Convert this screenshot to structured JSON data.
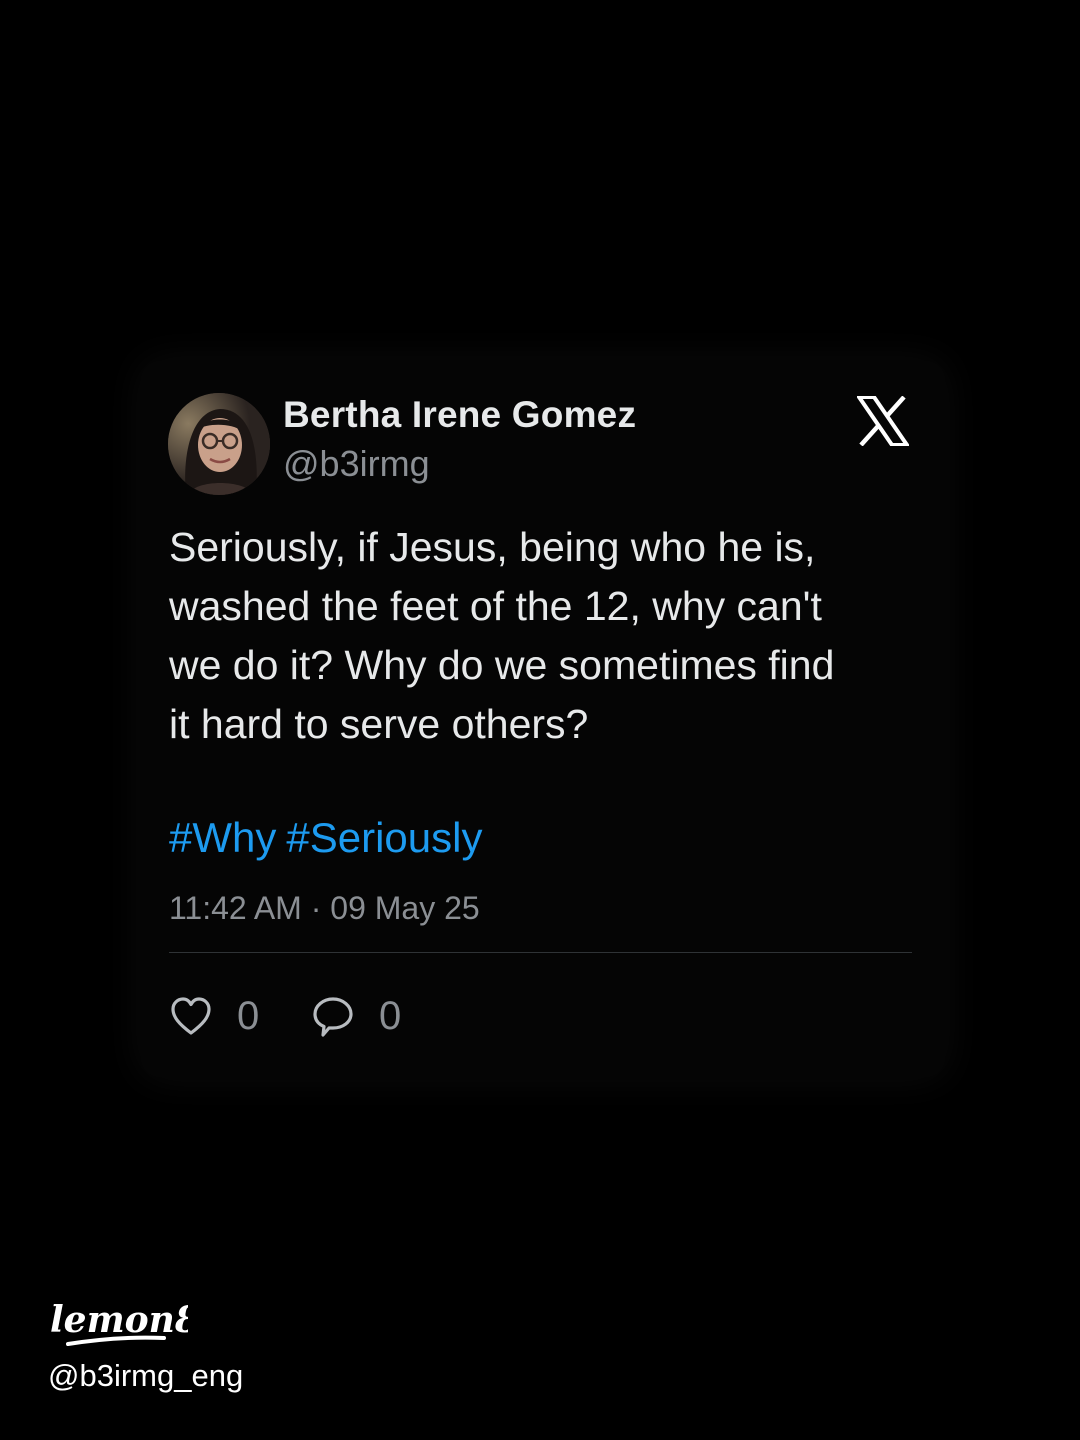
{
  "tweet": {
    "author": {
      "display_name": "Bertha Irene Gomez",
      "handle": "@b3irmg"
    },
    "text_lines": [
      "Seriously, if Jesus, being who he is,",
      "washed the feet of the 12, why can't",
      "we do it? Why do we sometimes find",
      "it hard to serve others?"
    ],
    "hashtags": [
      "#Why",
      "#Seriously"
    ],
    "timestamp": "11:42 AM · 09 May 25",
    "actions": {
      "likes": {
        "icon": "heart-icon",
        "count": "0"
      },
      "replies": {
        "icon": "speech-bubble-icon",
        "count": "0"
      }
    },
    "platform_icon": "x-logo-icon"
  },
  "watermark": {
    "logo_text": "lemon8",
    "handle": "@b3irmg_eng"
  },
  "colors": {
    "background": "#000000",
    "card": "#050505",
    "text_primary": "#e7e9ea",
    "text_secondary": "#8b8f94",
    "hashtag": "#1d9bf0",
    "divider": "#2f3336"
  }
}
